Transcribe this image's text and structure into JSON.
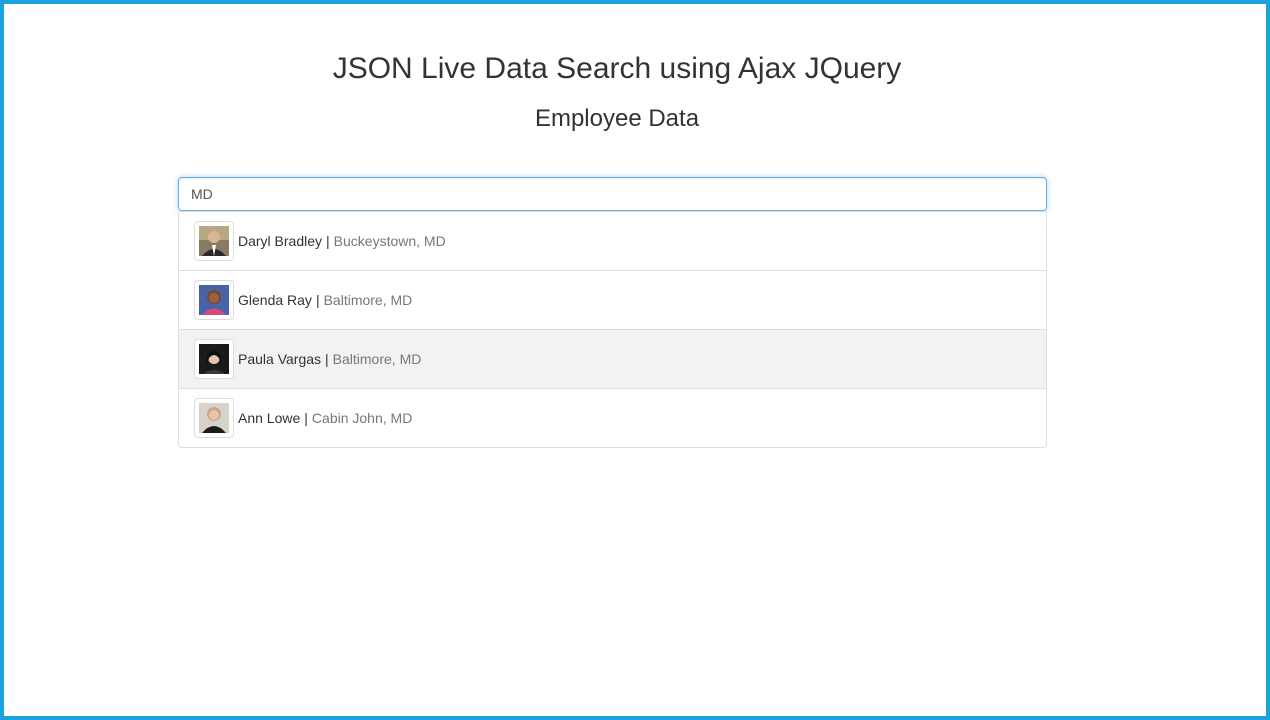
{
  "page": {
    "title": "JSON Live Data Search using Ajax JQuery",
    "subtitle": "Employee Data"
  },
  "search": {
    "value": "MD"
  },
  "results": [
    {
      "name": "Daryl Bradley",
      "separator": "|",
      "location": "Buckeystown, MD",
      "avatar_icon": "person-photo-icon"
    },
    {
      "name": "Glenda Ray",
      "separator": "|",
      "location": "Baltimore, MD",
      "avatar_icon": "person-photo-icon"
    },
    {
      "name": "Paula Vargas",
      "separator": "|",
      "location": "Baltimore, MD",
      "avatar_icon": "person-photo-icon"
    },
    {
      "name": "Ann Lowe",
      "separator": "|",
      "location": "Cabin John, MD",
      "avatar_icon": "person-photo-icon"
    }
  ],
  "colors": {
    "frame_border": "#1aa3dd",
    "input_focus": "#66afe9",
    "hover_row": "#f2f2f2"
  }
}
